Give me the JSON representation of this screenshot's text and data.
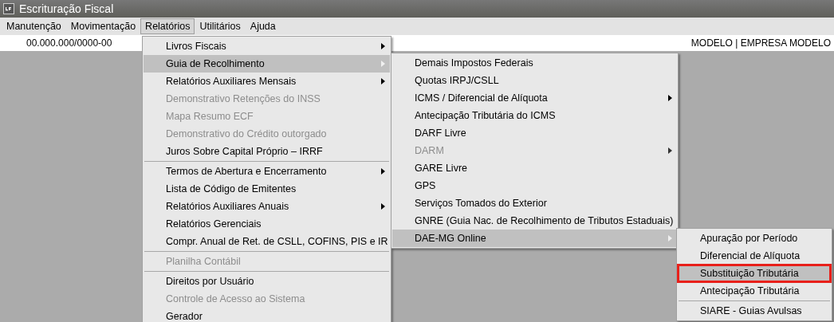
{
  "window": {
    "title": "Escrituração Fiscal"
  },
  "menubar": [
    {
      "label": "Manutenção",
      "selected": false
    },
    {
      "label": "Movimentação",
      "selected": false
    },
    {
      "label": "Relatórios",
      "selected": true
    },
    {
      "label": "Utilitários",
      "selected": false
    },
    {
      "label": "Ajuda",
      "selected": false
    }
  ],
  "info_bar": {
    "cnpj": "00.000.000/0000-00",
    "company": "MODELO | EMPRESA MODELO"
  },
  "menus": [
    {
      "items": [
        {
          "kind": "item",
          "label": "Livros Fiscais",
          "disabled": false,
          "submenu": true,
          "selected": false,
          "outlined": false
        },
        {
          "kind": "item",
          "label": "Guia de Recolhimento",
          "disabled": false,
          "submenu": true,
          "selected": true,
          "outlined": false
        },
        {
          "kind": "item",
          "label": "Relatórios Auxiliares Mensais",
          "disabled": false,
          "submenu": true,
          "selected": false,
          "outlined": false
        },
        {
          "kind": "item",
          "label": "Demonstrativo Retenções do INSS",
          "disabled": true,
          "submenu": false,
          "selected": false,
          "outlined": false
        },
        {
          "kind": "item",
          "label": "Mapa Resumo ECF",
          "disabled": true,
          "submenu": false,
          "selected": false,
          "outlined": false
        },
        {
          "kind": "item",
          "label": "Demonstrativo do Crédito outorgado",
          "disabled": true,
          "submenu": false,
          "selected": false,
          "outlined": false
        },
        {
          "kind": "item",
          "label": "Juros Sobre Capital Próprio – IRRF",
          "disabled": false,
          "submenu": false,
          "selected": false,
          "outlined": false
        },
        {
          "kind": "separator"
        },
        {
          "kind": "item",
          "label": "Termos de Abertura e Encerramento",
          "disabled": false,
          "submenu": true,
          "selected": false,
          "outlined": false
        },
        {
          "kind": "item",
          "label": "Lista de Código de Emitentes",
          "disabled": false,
          "submenu": false,
          "selected": false,
          "outlined": false
        },
        {
          "kind": "item",
          "label": "Relatórios Auxiliares Anuais",
          "disabled": false,
          "submenu": true,
          "selected": false,
          "outlined": false
        },
        {
          "kind": "item",
          "label": "Relatórios Gerenciais",
          "disabled": false,
          "submenu": false,
          "selected": false,
          "outlined": false
        },
        {
          "kind": "item",
          "label": "Compr. Anual de Ret. de CSLL, COFINS,  PIS e IR",
          "disabled": false,
          "submenu": false,
          "selected": false,
          "outlined": false
        },
        {
          "kind": "separator"
        },
        {
          "kind": "item",
          "label": "Planilha Contábil",
          "disabled": true,
          "submenu": false,
          "selected": false,
          "outlined": false
        },
        {
          "kind": "separator"
        },
        {
          "kind": "item",
          "label": "Direitos por Usuário",
          "disabled": false,
          "submenu": false,
          "selected": false,
          "outlined": false
        },
        {
          "kind": "item",
          "label": "Controle de Acesso ao Sistema",
          "disabled": true,
          "submenu": false,
          "selected": false,
          "outlined": false
        },
        {
          "kind": "item",
          "label": "Gerador",
          "disabled": false,
          "submenu": false,
          "selected": false,
          "outlined": false
        }
      ]
    },
    {
      "items": [
        {
          "kind": "item",
          "label": "Demais Impostos Federais",
          "disabled": false,
          "submenu": false,
          "selected": false,
          "outlined": false
        },
        {
          "kind": "item",
          "label": "Quotas IRPJ/CSLL",
          "disabled": false,
          "submenu": false,
          "selected": false,
          "outlined": false
        },
        {
          "kind": "item",
          "label": "ICMS / Diferencial de Alíquota",
          "disabled": false,
          "submenu": true,
          "selected": false,
          "outlined": false
        },
        {
          "kind": "item",
          "label": "Antecipação Tributária do ICMS",
          "disabled": false,
          "submenu": false,
          "selected": false,
          "outlined": false
        },
        {
          "kind": "item",
          "label": "DARF Livre",
          "disabled": false,
          "submenu": false,
          "selected": false,
          "outlined": false
        },
        {
          "kind": "item",
          "label": "DARM",
          "disabled": true,
          "submenu": true,
          "selected": false,
          "outlined": false
        },
        {
          "kind": "item",
          "label": "GARE Livre",
          "disabled": false,
          "submenu": false,
          "selected": false,
          "outlined": false
        },
        {
          "kind": "item",
          "label": "GPS",
          "disabled": false,
          "submenu": false,
          "selected": false,
          "outlined": false
        },
        {
          "kind": "item",
          "label": "Serviços Tomados do Exterior",
          "disabled": false,
          "submenu": false,
          "selected": false,
          "outlined": false
        },
        {
          "kind": "item",
          "label": "GNRE (Guia Nac. de Recolhimento de Tributos Estaduais)",
          "disabled": false,
          "submenu": false,
          "selected": false,
          "outlined": false
        },
        {
          "kind": "item",
          "label": "DAE-MG Online",
          "disabled": false,
          "submenu": true,
          "selected": true,
          "outlined": false
        }
      ]
    },
    {
      "items": [
        {
          "kind": "item",
          "label": "Apuração por Período",
          "disabled": false,
          "submenu": false,
          "selected": false,
          "outlined": false
        },
        {
          "kind": "item",
          "label": "Diferencial de Alíquota",
          "disabled": false,
          "submenu": false,
          "selected": false,
          "outlined": false
        },
        {
          "kind": "item",
          "label": "Substituição Tributária",
          "disabled": false,
          "submenu": false,
          "selected": true,
          "outlined": true
        },
        {
          "kind": "item",
          "label": "Antecipação Tributária",
          "disabled": false,
          "submenu": false,
          "selected": false,
          "outlined": false
        },
        {
          "kind": "separator"
        },
        {
          "kind": "item",
          "label": "SIARE - Guias Avulsas",
          "disabled": false,
          "submenu": false,
          "selected": false,
          "outlined": false
        }
      ]
    }
  ]
}
